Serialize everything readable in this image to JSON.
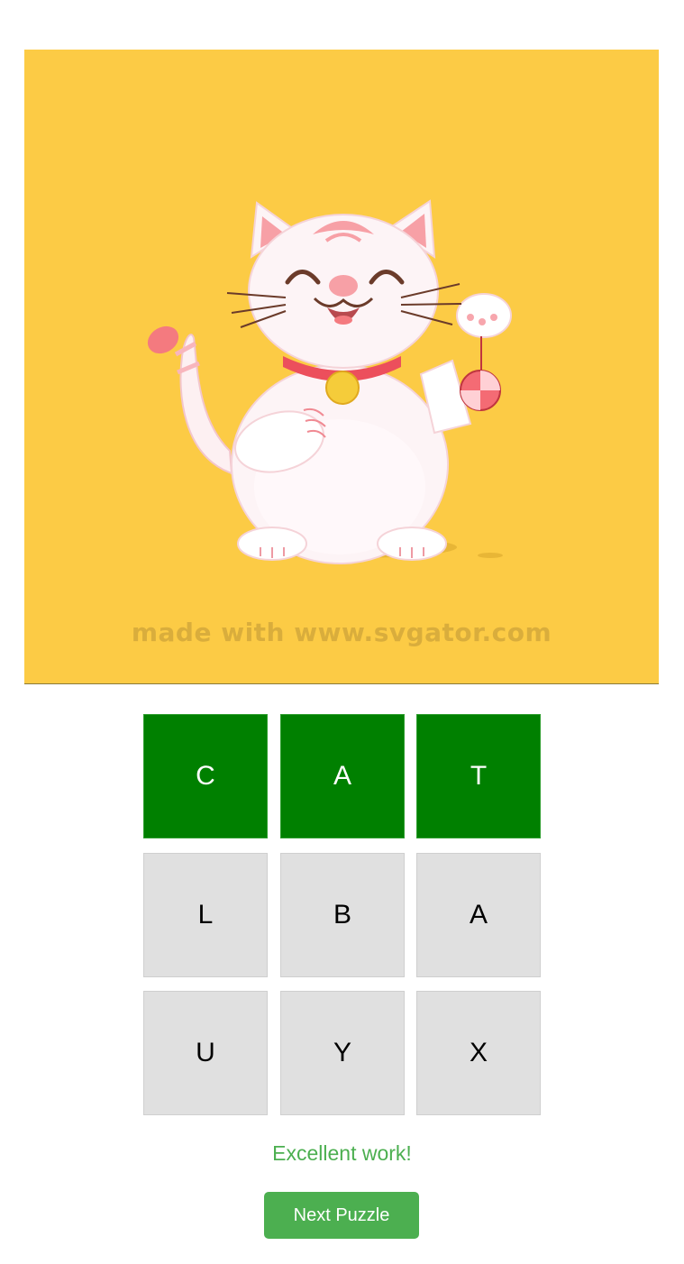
{
  "puzzle": {
    "image_subject": "lucky-cat-illustration",
    "image_background": "#fccb45",
    "watermark": "made with www.svgator.com"
  },
  "grid": {
    "rows": [
      [
        {
          "letter": "C",
          "state": "solved"
        },
        {
          "letter": "A",
          "state": "solved"
        },
        {
          "letter": "T",
          "state": "solved"
        }
      ],
      [
        {
          "letter": "L",
          "state": "unused"
        },
        {
          "letter": "B",
          "state": "unused"
        },
        {
          "letter": "A",
          "state": "unused"
        }
      ],
      [
        {
          "letter": "U",
          "state": "unused"
        },
        {
          "letter": "Y",
          "state": "unused"
        },
        {
          "letter": "X",
          "state": "unused"
        }
      ]
    ]
  },
  "colors": {
    "solved": "#008000",
    "unused": "#e0e0e0",
    "accent": "#4caf50"
  },
  "feedback": {
    "message": "Excellent work!"
  },
  "actions": {
    "next_label": "Next Puzzle"
  }
}
